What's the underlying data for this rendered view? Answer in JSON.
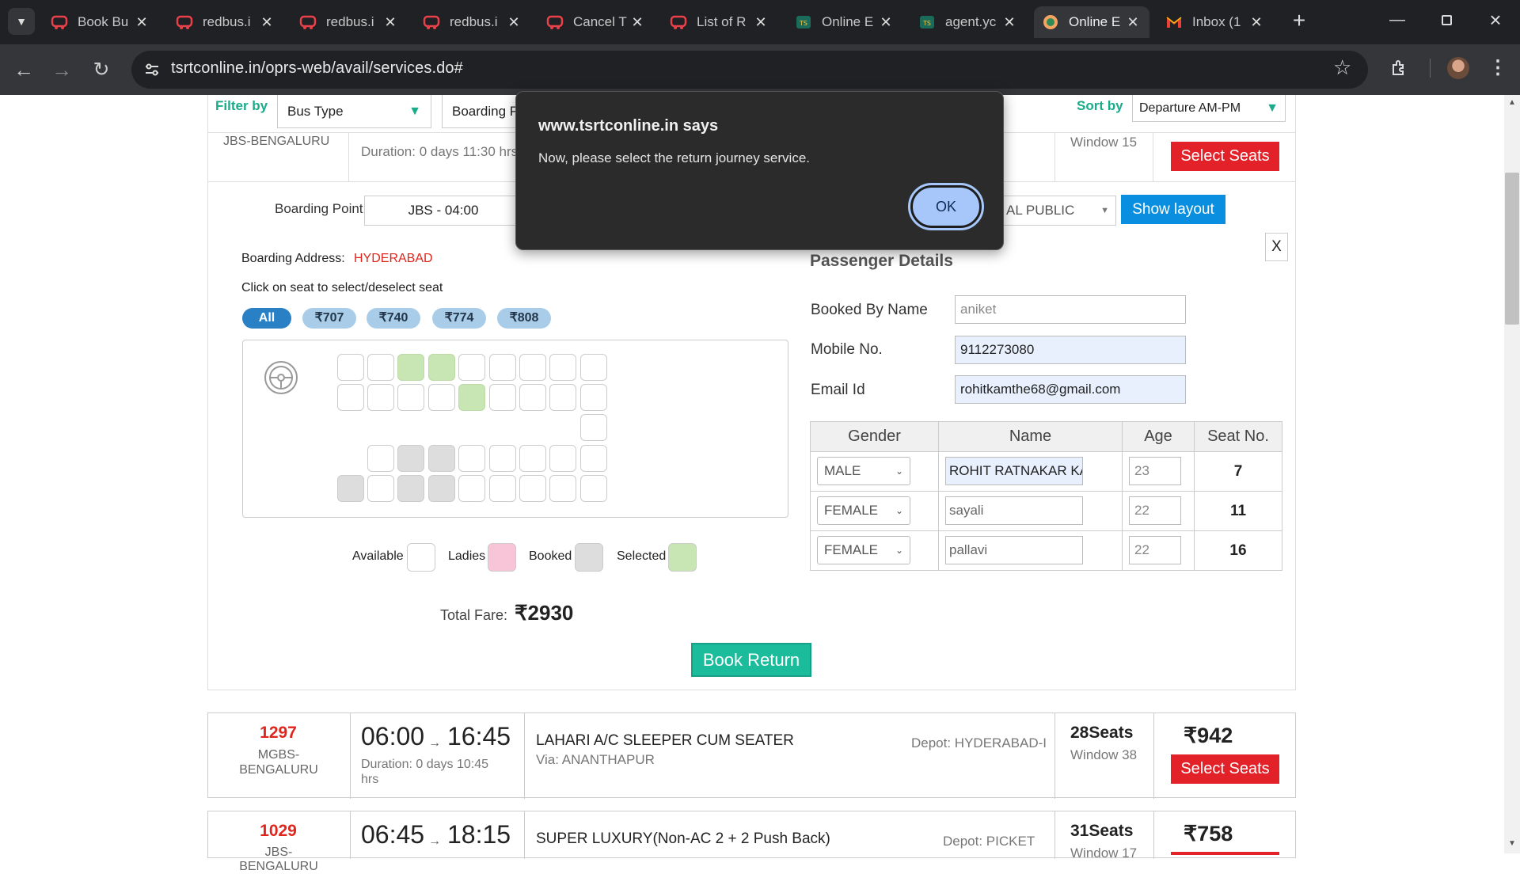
{
  "tabs": [
    {
      "title": "Book Bu",
      "icon": "redbus-icon"
    },
    {
      "title": "redbus.i",
      "icon": "redbus-icon"
    },
    {
      "title": "redbus.i",
      "icon": "redbus-icon"
    },
    {
      "title": "redbus.i",
      "icon": "redbus-icon"
    },
    {
      "title": "Cancel T",
      "icon": "redbus-icon"
    },
    {
      "title": "List of R",
      "icon": "redbus-icon"
    },
    {
      "title": "Online E",
      "icon": "tsrtc-icon"
    },
    {
      "title": "agent.yc",
      "icon": "tsrtc-icon"
    },
    {
      "title": "Online E",
      "icon": "tsrtc-icon",
      "active": true
    },
    {
      "title": "Inbox (1",
      "icon": "gmail-icon"
    }
  ],
  "browser": {
    "url": "tsrtconline.in/oprs-web/avail/services.do#"
  },
  "filter": {
    "label": "Filter by",
    "bus_type": "Bus Type",
    "boarding": "Boarding P",
    "sort_label": "Sort by",
    "sort_value": "Departure AM-PM"
  },
  "top_service": {
    "route": "JBS-BENGALURU",
    "duration": "Duration: 0 days 11:30 hrs",
    "window": "Window 15",
    "select": "Select Seats"
  },
  "layout_panel": {
    "boarding_label": "Boarding Point",
    "boarding_value": "JBS - 04:00",
    "quota_value": "AL PUBLIC",
    "show_layout": "Show layout",
    "close": "X",
    "boarding_address_label": "Boarding Address:",
    "boarding_address": "HYDERABAD",
    "instruction": "Click on seat to select/deselect seat",
    "fare_filters": [
      "All",
      "₹707",
      "₹740",
      "₹774",
      "₹808"
    ],
    "legend": {
      "available": "Available",
      "ladies": "Ladies",
      "booked": "Booked",
      "selected": "Selected"
    },
    "total_fare_label": "Total Fare:",
    "total_fare": "₹2930",
    "book_return": "Book Return"
  },
  "passenger": {
    "title": "Passenger Details",
    "booked_by_label": "Booked By Name",
    "booked_by": "aniket",
    "mobile_label": "Mobile No.",
    "mobile": "9112273080",
    "email_label": "Email Id",
    "email": "rohitkamthe68@gmail.com",
    "headers": [
      "Gender",
      "Name",
      "Age",
      "Seat No."
    ],
    "rows": [
      {
        "gender": "MALE",
        "name": "ROHIT RATNAKAR KA",
        "age": "23",
        "seat": "7"
      },
      {
        "gender": "FEMALE",
        "name": "sayali",
        "age": "22",
        "seat": "11"
      },
      {
        "gender": "FEMALE",
        "name": "pallavi",
        "age": "22",
        "seat": "16"
      }
    ]
  },
  "dialog": {
    "title": "www.tsrtconline.in says",
    "message": "Now, please select the return journey service.",
    "ok": "OK"
  },
  "services": [
    {
      "number": "1297",
      "route": "MGBS-BENGALURU",
      "depart": "06:00",
      "arrive": "16:45",
      "duration": "Duration: 0 days 10:45 hrs",
      "name": "LAHARI A/C SLEEPER CUM SEATER",
      "via": "Via: ANANTHAPUR",
      "depot": "Depot: HYDERABAD-I",
      "seats": "28Seats",
      "window": "Window 38",
      "fare": "₹942",
      "select": "Select Seats"
    },
    {
      "number": "1029",
      "route": "JBS-BENGALURU",
      "depart": "06:45",
      "arrive": "18:15",
      "name": "SUPER LUXURY(Non-AC 2 + 2 Push Back)",
      "depot": "Depot: PICKET",
      "seats": "31Seats",
      "window": "Window 17",
      "fare": "₹758"
    }
  ]
}
